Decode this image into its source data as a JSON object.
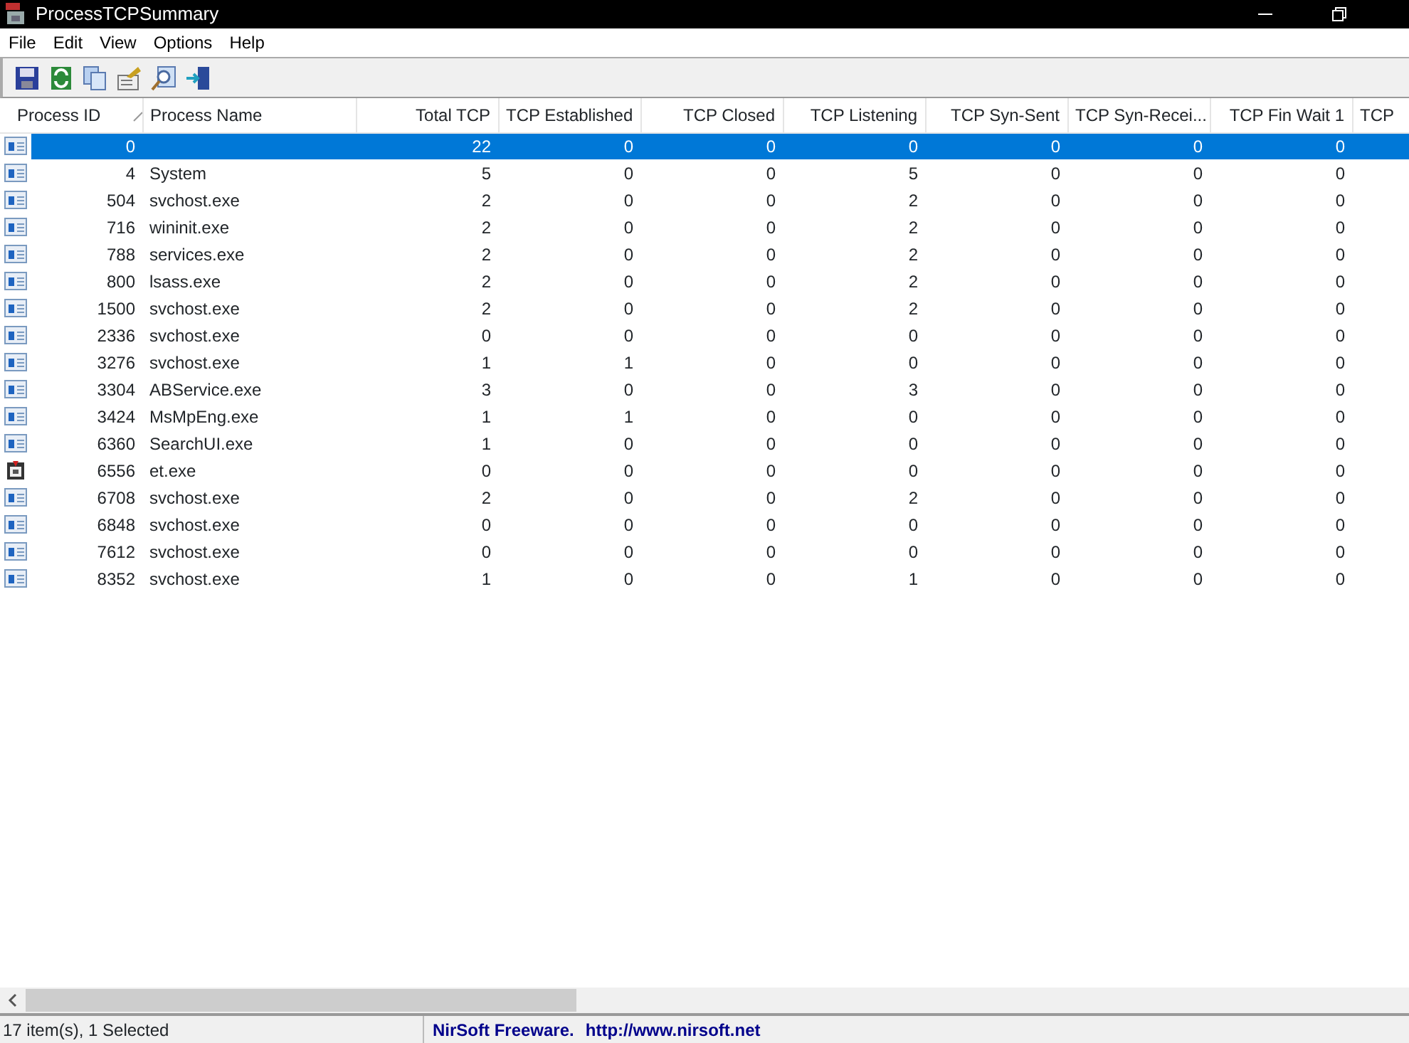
{
  "window": {
    "title": "ProcessTCPSummary"
  },
  "menu": [
    "File",
    "Edit",
    "View",
    "Options",
    "Help"
  ],
  "toolbar": [
    {
      "kind": "save"
    },
    {
      "kind": "refresh"
    },
    {
      "kind": "copy"
    },
    {
      "kind": "properties"
    },
    {
      "kind": "find"
    },
    {
      "kind": "exit"
    }
  ],
  "table": {
    "columns": [
      {
        "label": "Process ID",
        "sorted": true
      },
      {
        "label": "Process Name",
        "sorted": false
      },
      {
        "label": "Total TCP",
        "sorted": false
      },
      {
        "label": "TCP Established",
        "sorted": false
      },
      {
        "label": "TCP Closed",
        "sorted": false
      },
      {
        "label": "TCP Listening",
        "sorted": false
      },
      {
        "label": "TCP Syn-Sent",
        "sorted": false
      },
      {
        "label": "TCP Syn-Recei...",
        "sorted": false
      },
      {
        "label": "TCP Fin Wait 1",
        "sorted": false
      },
      {
        "label": "TCP",
        "sorted": false
      }
    ],
    "rows": [
      {
        "kind": "app",
        "selected": true,
        "cells": [
          "0",
          "",
          "22",
          "0",
          "0",
          "0",
          "0",
          "0",
          "0"
        ]
      },
      {
        "kind": "app",
        "selected": false,
        "cells": [
          "4",
          "System",
          "5",
          "0",
          "0",
          "5",
          "0",
          "0",
          "0"
        ]
      },
      {
        "kind": "app",
        "selected": false,
        "cells": [
          "504",
          "svchost.exe",
          "2",
          "0",
          "0",
          "2",
          "0",
          "0",
          "0"
        ]
      },
      {
        "kind": "app",
        "selected": false,
        "cells": [
          "716",
          "wininit.exe",
          "2",
          "0",
          "0",
          "2",
          "0",
          "0",
          "0"
        ]
      },
      {
        "kind": "app",
        "selected": false,
        "cells": [
          "788",
          "services.exe",
          "2",
          "0",
          "0",
          "2",
          "0",
          "0",
          "0"
        ]
      },
      {
        "kind": "app",
        "selected": false,
        "cells": [
          "800",
          "lsass.exe",
          "2",
          "0",
          "0",
          "2",
          "0",
          "0",
          "0"
        ]
      },
      {
        "kind": "app",
        "selected": false,
        "cells": [
          "1500",
          "svchost.exe",
          "2",
          "0",
          "0",
          "2",
          "0",
          "0",
          "0"
        ]
      },
      {
        "kind": "app",
        "selected": false,
        "cells": [
          "2336",
          "svchost.exe",
          "0",
          "0",
          "0",
          "0",
          "0",
          "0",
          "0"
        ]
      },
      {
        "kind": "app",
        "selected": false,
        "cells": [
          "3276",
          "svchost.exe",
          "1",
          "1",
          "0",
          "0",
          "0",
          "0",
          "0"
        ]
      },
      {
        "kind": "app",
        "selected": false,
        "cells": [
          "3304",
          "ABService.exe",
          "3",
          "0",
          "0",
          "3",
          "0",
          "0",
          "0"
        ]
      },
      {
        "kind": "app",
        "selected": false,
        "cells": [
          "3424",
          "MsMpEng.exe",
          "1",
          "1",
          "0",
          "0",
          "0",
          "0",
          "0"
        ]
      },
      {
        "kind": "app",
        "selected": false,
        "cells": [
          "6360",
          "SearchUI.exe",
          "1",
          "0",
          "0",
          "0",
          "0",
          "0",
          "0"
        ]
      },
      {
        "kind": "package",
        "selected": false,
        "cells": [
          "6556",
          "et.exe",
          "0",
          "0",
          "0",
          "0",
          "0",
          "0",
          "0"
        ]
      },
      {
        "kind": "app",
        "selected": false,
        "cells": [
          "6708",
          "svchost.exe",
          "2",
          "0",
          "0",
          "2",
          "0",
          "0",
          "0"
        ]
      },
      {
        "kind": "app",
        "selected": false,
        "cells": [
          "6848",
          "svchost.exe",
          "0",
          "0",
          "0",
          "0",
          "0",
          "0",
          "0"
        ]
      },
      {
        "kind": "app",
        "selected": false,
        "cells": [
          "7612",
          "svchost.exe",
          "0",
          "0",
          "0",
          "0",
          "0",
          "0",
          "0"
        ]
      },
      {
        "kind": "app",
        "selected": false,
        "cells": [
          "8352",
          "svchost.exe",
          "1",
          "0",
          "0",
          "1",
          "0",
          "0",
          "0"
        ]
      }
    ]
  },
  "status_bar": {
    "items_text": "17 item(s), 1 Selected",
    "credit": "NirSoft Freeware.",
    "link": "http://www.nirsoft.net"
  }
}
